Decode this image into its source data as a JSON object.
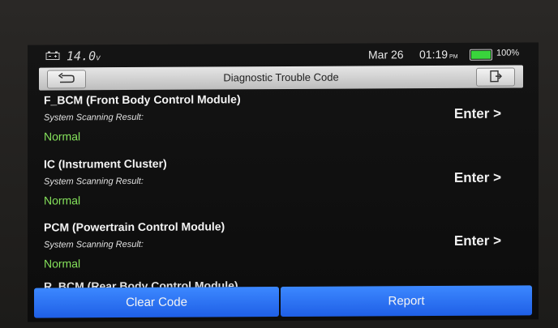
{
  "status": {
    "voltage": "14.0",
    "voltage_unit": "v",
    "date": "Mar 26",
    "time": "01:19",
    "ampm": "PM",
    "battery_percent": "100%",
    "battery_level": 1.0
  },
  "header": {
    "title": "Diagnostic Trouble Code",
    "back_icon": "back-arrow-icon",
    "exit_icon": "exit-door-icon"
  },
  "modules": [
    {
      "name": "F_BCM (Front Body Control Module)",
      "sub": "System Scanning Result:",
      "status": "Normal",
      "action": "Enter >"
    },
    {
      "name": "IC (Instrument Cluster)",
      "sub": "System Scanning Result:",
      "status": "Normal",
      "action": "Enter >"
    },
    {
      "name": "PCM (Powertrain Control Module)",
      "sub": "System Scanning Result:",
      "status": "Normal",
      "action": "Enter >"
    }
  ],
  "partial_item": "R_BCM (Rear Body Control Module)",
  "footer": {
    "clear_label": "Clear Code",
    "report_label": "Report"
  },
  "colors": {
    "status_green": "#86e35c",
    "button_blue": "#2a72f5",
    "battery_green": "#39d43c"
  }
}
